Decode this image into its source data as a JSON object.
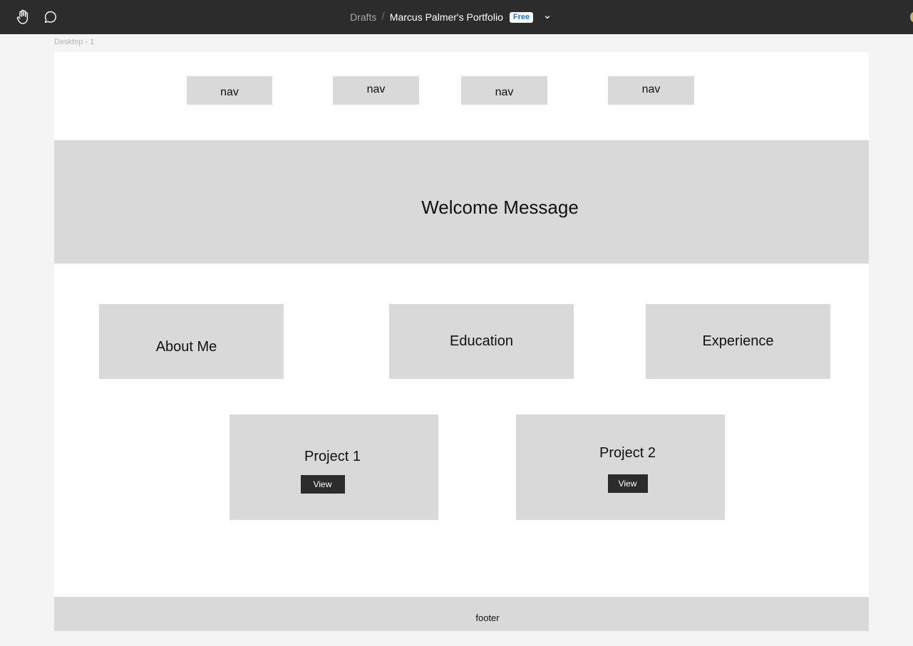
{
  "toolbar": {
    "hand_icon": "hand-icon",
    "comment_icon": "comment-icon",
    "breadcrumb_root": "Drafts",
    "breadcrumb_separator": "/",
    "file_name": "Marcus Palmer's Portfolio",
    "plan_badge": "Free",
    "chevron_icon": "chevron-down-icon"
  },
  "canvas": {
    "frame_label": "Desktop - 1"
  },
  "wireframe": {
    "nav_items": [
      "nav",
      "nav",
      "nav",
      "nav"
    ],
    "hero_text": "Welcome Message",
    "sections": [
      "About Me",
      "Education",
      "Experience"
    ],
    "projects": [
      {
        "title": "Project 1",
        "button": "View"
      },
      {
        "title": "Project 2",
        "button": "View"
      }
    ],
    "footer_text": "footer"
  },
  "colors": {
    "topbar": "#2c2c2c",
    "canvas_bg": "#f4f4f4",
    "frame_bg": "#ffffff",
    "placeholder": "#d9d9d9",
    "button": "#2c2c2c",
    "badge_text": "#1473e6"
  }
}
